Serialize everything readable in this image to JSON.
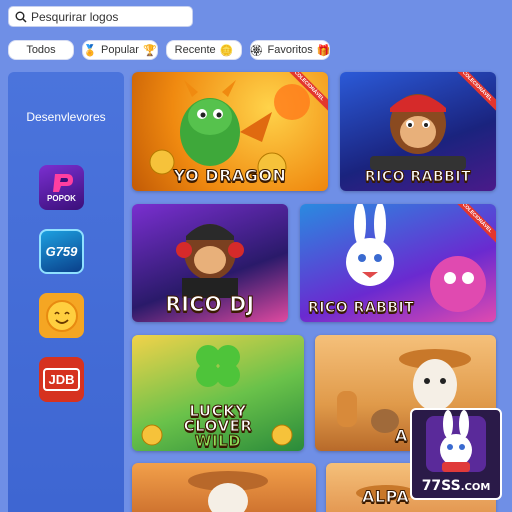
{
  "search": {
    "value": "Pesqurirar logos"
  },
  "filters": [
    {
      "label": "Todos"
    },
    {
      "label": "Popular"
    },
    {
      "label": "Recente"
    },
    {
      "label": "Favoritos"
    }
  ],
  "sidebar": {
    "title": "Desenvlevores",
    "providers": [
      {
        "name": "POPOK"
      },
      {
        "name": "G759"
      },
      {
        "name": "sun-logo"
      },
      {
        "name": "JDB"
      }
    ]
  },
  "games": [
    {
      "title": "YO DRAGON",
      "ribbon": "COLECIONÁVEL"
    },
    {
      "title": "RICO RABBIT",
      "ribbon": "COLECIONÁVEL"
    },
    {
      "title": "RICO DJ"
    },
    {
      "title": "RICO RABBIT",
      "ribbon": "COLECIONÁVEL"
    },
    {
      "title_line1": "LUCKY",
      "title_line2": "CLOVER",
      "title_line3": "WILD"
    },
    {
      "title": "A"
    },
    {
      "title": ""
    },
    {
      "title": "ALPA"
    }
  ],
  "badge": {
    "brand": "77SS",
    "suffix": ".COM"
  },
  "colors": {
    "background": "#6f8fe6",
    "sidebar": "#4b74dc",
    "ribbon": "#e3362e"
  }
}
